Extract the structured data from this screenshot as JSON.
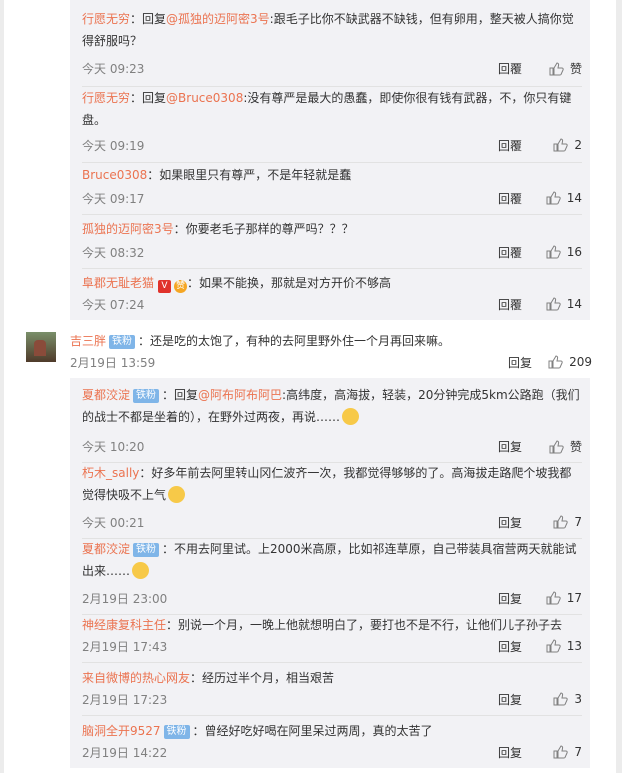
{
  "labels": {
    "reply": "回覆",
    "reply2": "回复",
    "praise": "赞",
    "reply_to": "回复"
  },
  "nested_top": [
    {
      "author": "行愿无穷",
      "prefix": "：回复",
      "at": "@孤独的迈阿密3号",
      "body": ":跟毛子比你不缺武器不缺钱，但有卵用，整天被人搞你觉得舒服吗？",
      "time": "今天 09:23",
      "reply_label": "回覆",
      "likes": "赞"
    },
    {
      "author": "行愿无穷",
      "prefix": "：回复",
      "at": "@Bruce0308",
      "body": ":没有尊严是最大的愚蠢，即使你很有钱有武器，不，你只有键盘。",
      "time": "今天 09:19",
      "reply_label": "回覆",
      "likes": "2"
    },
    {
      "author": "Bruce0308",
      "body": "：如果眼里只有尊严，不是年轻就是蠢",
      "time": "今天 09:17",
      "reply_label": "回覆",
      "likes": "14"
    },
    {
      "author": "孤独的迈阿密3号",
      "body": "：你要老毛子那样的尊严吗？？？",
      "time": "今天 08:32",
      "reply_label": "回覆",
      "likes": "16"
    },
    {
      "author": "阜郡无耻老猫",
      "badge_v": "V",
      "badge_lv": "赞",
      "body": "：如果不能换，那就是对方开价不够高",
      "time": "今天 07:24",
      "reply_label": "回覆",
      "likes": "14"
    }
  ],
  "main_comment": {
    "author": "吉三胖",
    "fan_badge": "铁粉",
    "body": "：还是吃的太饱了，有种的去阿里野外住一个月再回来嘛。",
    "time": "2月19日 13:59",
    "reply_label": "回复",
    "likes": "209"
  },
  "nested_bottom": [
    {
      "author": "夏都洨淀",
      "fan_badge": "铁粉",
      "prefix": "：回复",
      "at": "@阿布阿布阿巴",
      "body": ":高纬度，高海拔，轻装，20分钟完成5km公路跑（我们的战士不都是坐着的），在野外过两夜，再说……",
      "time": "今天 10:20",
      "reply_label": "回复",
      "likes": "赞"
    },
    {
      "author": "朽木_sally",
      "body": "：好多年前去阿里转山冈仁波齐一次，我都觉得够够的了。高海拔走路爬个坡我都觉得快吸不上气",
      "time": "今天 00:21",
      "reply_label": "回复",
      "likes": "7"
    },
    {
      "author": "夏都洨淀",
      "fan_badge": "铁粉",
      "body": "：不用去阿里试。上2000米高原，比如祁连草原，自己带装具宿营两天就能试出来……",
      "time": "2月19日 23:00",
      "reply_label": "回复",
      "likes": "17"
    },
    {
      "author": "神经康复科主任",
      "body": "：别说一个月，一晚上他就想明白了，要打也不是不行，让他们儿子孙子去",
      "time": "2月19日 17:43",
      "reply_label": "回复",
      "likes": "13"
    },
    {
      "author": "来自微博的热心网友",
      "body": "：经历过半个月，相当艰苦",
      "time": "2月19日 17:23",
      "reply_label": "回复",
      "likes": "3"
    },
    {
      "author": "脑洞全开9527",
      "fan_badge": "铁粉",
      "body": "：曾经好吃好喝在阿里呆过两周，真的太苦了",
      "time": "2月19日 14:22",
      "reply_label": "回复",
      "likes": "7"
    }
  ]
}
